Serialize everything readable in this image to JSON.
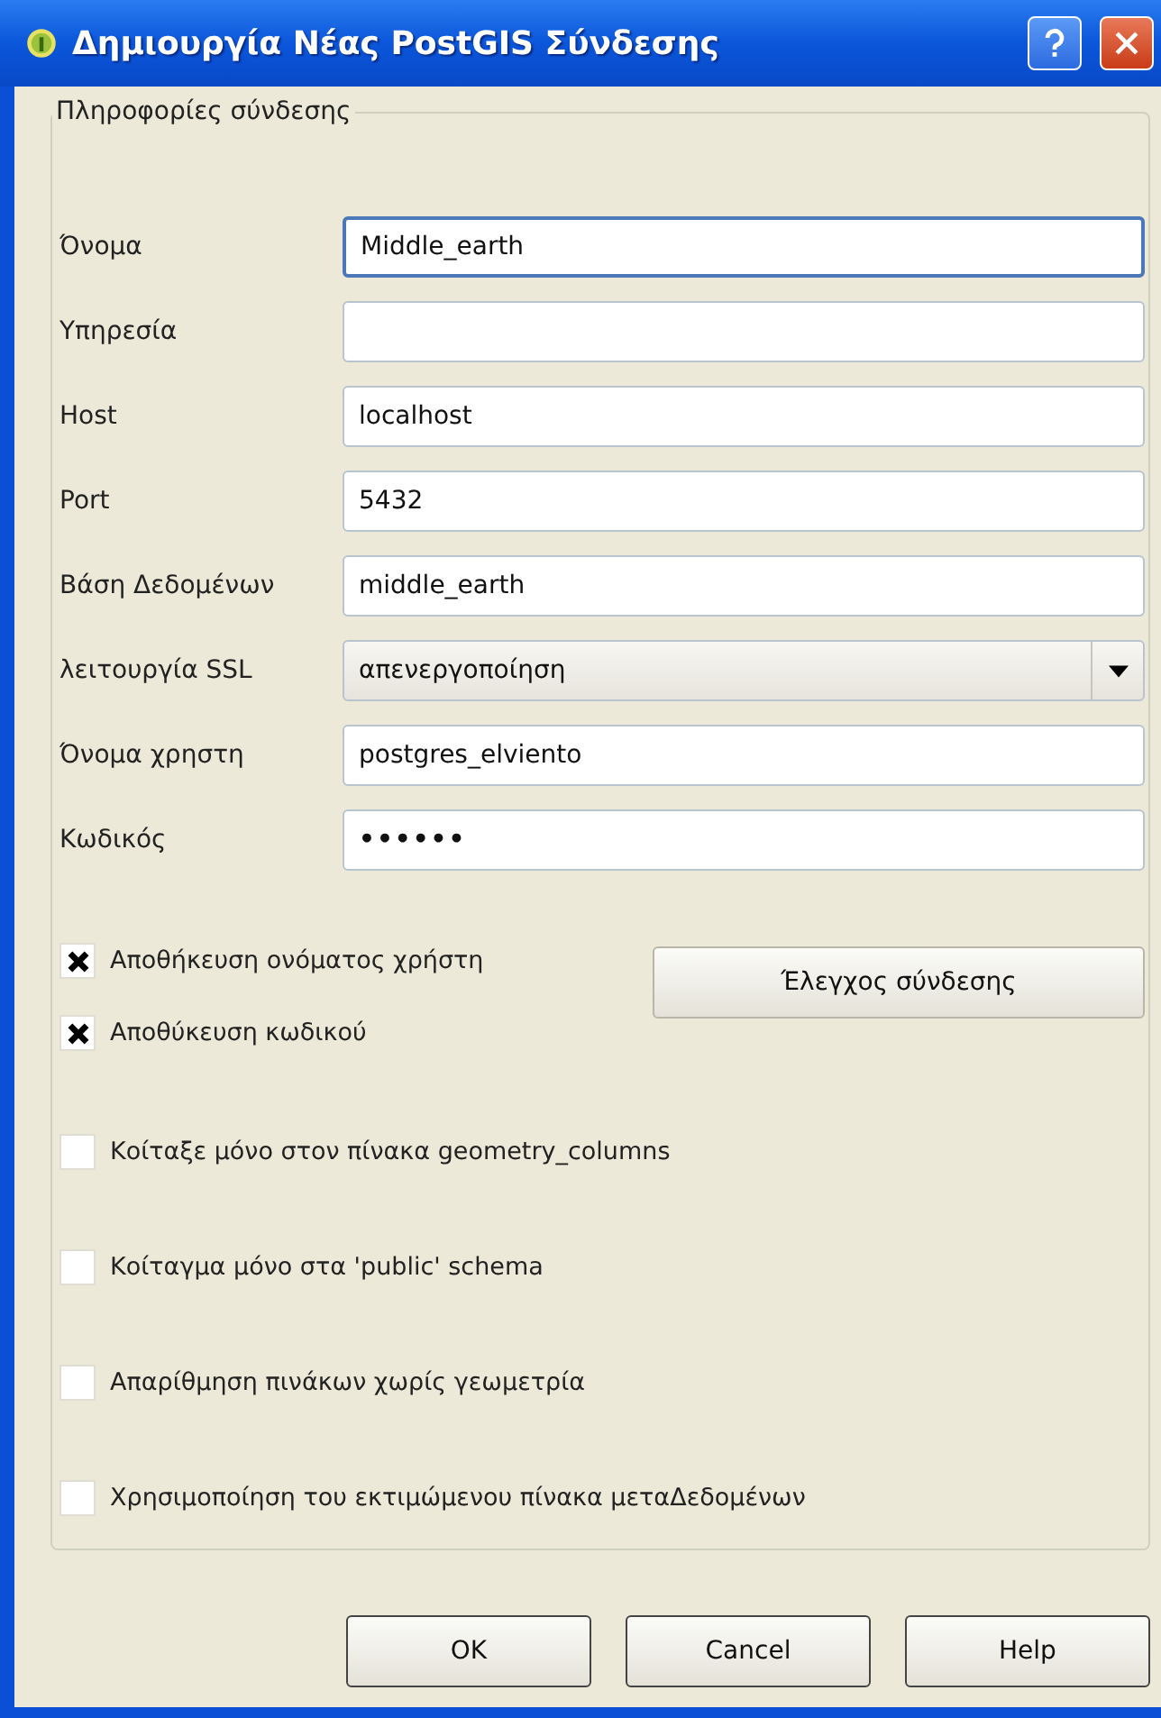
{
  "window": {
    "title": "Δημιουργία Νέας PostGIS Σύνδεσης"
  },
  "group": {
    "title": "Πληροφορίες σύνδεσης",
    "fields": [
      {
        "label": "Όνομα",
        "kind": "text",
        "value": "Middle_earth",
        "focused": true
      },
      {
        "label": "Υπηρεσία",
        "kind": "text",
        "focused": false
      },
      {
        "label": "Host",
        "kind": "text",
        "value": "localhost",
        "focused": false
      },
      {
        "label": "Port",
        "kind": "text",
        "value": "5432",
        "focused": false
      },
      {
        "label": "Βάση Δεδομένων",
        "kind": "text",
        "value": "middle_earth",
        "focused": false
      },
      {
        "label": "λειτουργία SSL",
        "kind": "select",
        "value": "απενεργοποίηση",
        "focused": false
      },
      {
        "label": "Όνομα χρηστη",
        "kind": "text",
        "value": "postgres_elviento",
        "focused": false
      },
      {
        "label": "Κωδικός",
        "kind": "password",
        "value": "••••••",
        "focused": false
      }
    ],
    "save_options": [
      {
        "label": "Αποθήκευση ονόματος χρήστη",
        "checked": true
      },
      {
        "label": "Αποθύκευση κωδικού",
        "checked": true
      }
    ],
    "test_button": "Έλεγχος σύνδεσης",
    "options": [
      {
        "label": "Κοίταξε μόνο στον πίνακα geometry_columns",
        "checked": false
      },
      {
        "label": "Κοίταγμα μόνο στα 'public' schema",
        "checked": false
      },
      {
        "label": "Απαρίθμηση πινάκων χωρίς γεωμετρία",
        "checked": false
      },
      {
        "label": "Χρησιμοποίηση του εκτιμώμενου πίνακα μεταΔεδομένων",
        "checked": false
      }
    ]
  },
  "buttons": [
    "OK",
    "Cancel",
    "Help"
  ]
}
